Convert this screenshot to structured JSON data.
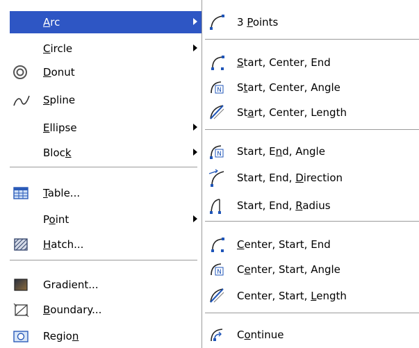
{
  "main_menu": {
    "items": [
      {
        "pre": "",
        "key": "A",
        "post": "rc",
        "icon": "",
        "submenu": true,
        "active": true
      },
      {
        "pre": "",
        "key": "C",
        "post": "ircle",
        "icon": "",
        "submenu": true
      },
      {
        "pre": "",
        "key": "D",
        "post": "onut",
        "icon": "donut-icon",
        "submenu": false
      },
      {
        "pre": "",
        "key": "S",
        "post": "pline",
        "icon": "spline-icon",
        "submenu": false
      },
      {
        "pre": "",
        "key": "E",
        "post": "llipse",
        "icon": "",
        "submenu": true
      },
      {
        "pre": "Bloc",
        "key": "k",
        "post": "",
        "icon": "",
        "submenu": true
      },
      {
        "pre": "",
        "key": "T",
        "post": "able...",
        "icon": "table-icon",
        "submenu": false
      },
      {
        "pre": "P",
        "key": "o",
        "post": "int",
        "icon": "",
        "submenu": true
      },
      {
        "pre": "",
        "key": "H",
        "post": "atch...",
        "icon": "hatch-icon",
        "submenu": false
      },
      {
        "pre": "Gradient...",
        "key": "",
        "post": "",
        "icon": "gradient-icon",
        "submenu": false
      },
      {
        "pre": "",
        "key": "B",
        "post": "oundary...",
        "icon": "boundary-icon",
        "submenu": false
      },
      {
        "pre": "Regio",
        "key": "n",
        "post": "",
        "icon": "region-icon",
        "submenu": false
      }
    ]
  },
  "arc_submenu": {
    "items": [
      {
        "pre": "3 ",
        "key": "P",
        "post": "oints",
        "icon": "arc-3-points-icon"
      },
      {
        "pre": "",
        "key": "S",
        "post": "tart, Center, End",
        "icon": "arc-start-center-end-icon"
      },
      {
        "pre": "S",
        "key": "t",
        "post": "art, Center, Angle",
        "icon": "arc-start-center-angle-icon"
      },
      {
        "pre": "St",
        "key": "a",
        "post": "rt, Center, Length",
        "icon": "arc-start-center-length-icon"
      },
      {
        "pre": "Start, E",
        "key": "n",
        "post": "d, Angle",
        "icon": "arc-start-end-angle-icon"
      },
      {
        "pre": "Start, End, ",
        "key": "D",
        "post": "irection",
        "icon": "arc-start-end-direction-icon"
      },
      {
        "pre": "Start, End, ",
        "key": "R",
        "post": "adius",
        "icon": "arc-start-end-radius-icon"
      },
      {
        "pre": "",
        "key": "C",
        "post": "enter, Start, End",
        "icon": "arc-center-start-end-icon"
      },
      {
        "pre": "C",
        "key": "e",
        "post": "nter, Start, Angle",
        "icon": "arc-center-start-angle-icon"
      },
      {
        "pre": "Center, Start, ",
        "key": "L",
        "post": "ength",
        "icon": "arc-center-start-length-icon"
      },
      {
        "pre": "C",
        "key": "o",
        "post": "ntinue",
        "icon": "arc-continue-icon"
      }
    ]
  },
  "colors": {
    "highlight": "#2e56c4",
    "separator": "#9a9a9a",
    "icon_blue": "#1f55b8"
  }
}
